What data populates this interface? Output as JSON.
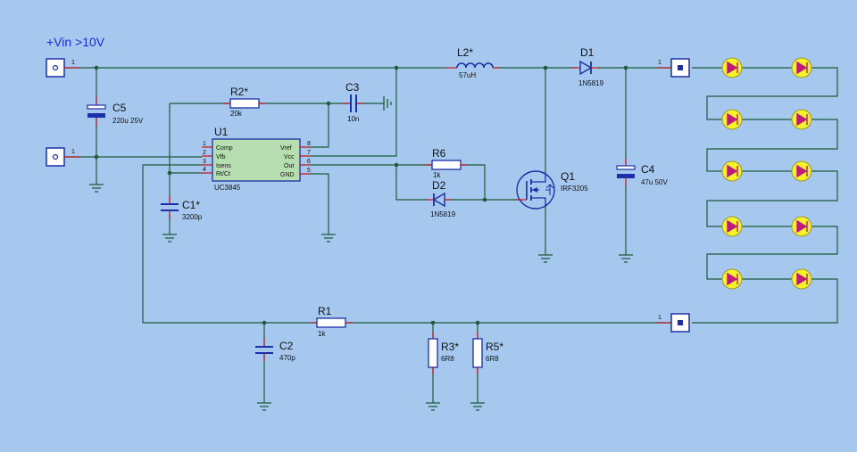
{
  "supply": {
    "label": "+Vin  >10V"
  },
  "ic": {
    "ref": "U1",
    "part": "UC3845",
    "pins_left": [
      {
        "num": "1",
        "name": "Comp"
      },
      {
        "num": "2",
        "name": "Vfb"
      },
      {
        "num": "3",
        "name": "Isens"
      },
      {
        "num": "4",
        "name": "Rt/Ct"
      }
    ],
    "pins_right": [
      {
        "num": "8",
        "name": "Vref"
      },
      {
        "num": "7",
        "name": "Vcc"
      },
      {
        "num": "6",
        "name": "Out"
      },
      {
        "num": "5",
        "name": "GND"
      }
    ]
  },
  "components": {
    "C5": {
      "ref": "C5",
      "value": "220u  25V"
    },
    "R2": {
      "ref": "R2*",
      "value": "20k"
    },
    "C3": {
      "ref": "C3",
      "value": "10n"
    },
    "L2": {
      "ref": "L2*",
      "value": "57uH"
    },
    "D1": {
      "ref": "D1",
      "value": "1N5819"
    },
    "C4": {
      "ref": "C4",
      "value": "47u  50V"
    },
    "R6": {
      "ref": "R6",
      "value": "1k"
    },
    "D2": {
      "ref": "D2",
      "value": "1N5819"
    },
    "Q1": {
      "ref": "Q1",
      "value": "IRF3205"
    },
    "C1": {
      "ref": "C1*",
      "value": "3200p"
    },
    "R1": {
      "ref": "R1",
      "value": "1k"
    },
    "C2": {
      "ref": "C2",
      "value": "470p"
    },
    "R3": {
      "ref": "R3*",
      "value": "6R8"
    },
    "R5": {
      "ref": "R5*",
      "value": "6R8"
    }
  },
  "connectors": {
    "pin_label": "1"
  },
  "colors": {
    "background": "#a6c8ee",
    "wire": "#1e5a3c",
    "lead": "#c01818",
    "component": "#1c2fa8",
    "ic_fill": "#b6deb0",
    "led_fill": "#f5f22a",
    "led_triangle": "#c0187c"
  }
}
